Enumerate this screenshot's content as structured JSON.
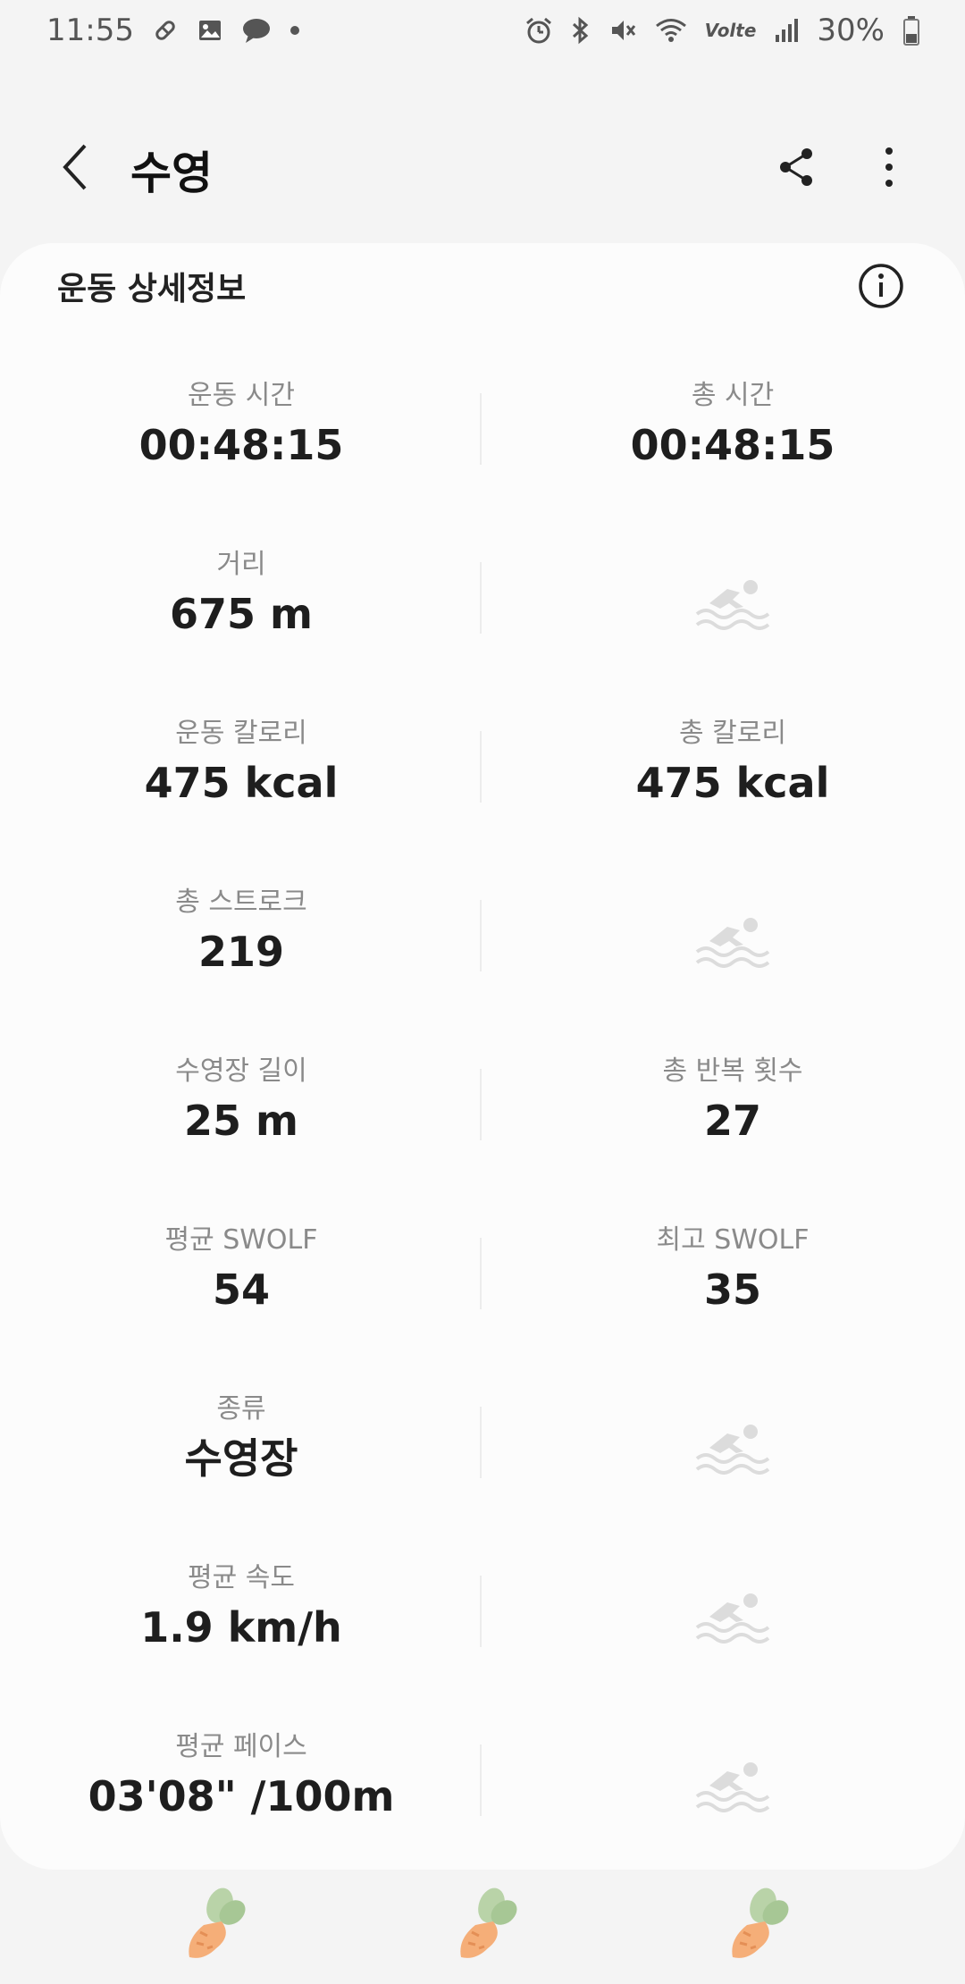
{
  "status": {
    "time": "11:55",
    "battery": "30%",
    "network": "Volte"
  },
  "header": {
    "title": "수영"
  },
  "card": {
    "title": "운동 상세정보"
  },
  "metrics": [
    {
      "left": {
        "label": "운동 시간",
        "value": "00:48:15"
      },
      "right": {
        "label": "총 시간",
        "value": "00:48:15"
      }
    },
    {
      "left": {
        "label": "거리",
        "value": "675 m"
      },
      "right": null
    },
    {
      "left": {
        "label": "운동 칼로리",
        "value": "475 kcal"
      },
      "right": {
        "label": "총 칼로리",
        "value": "475 kcal"
      }
    },
    {
      "left": {
        "label": "총 스트로크",
        "value": "219"
      },
      "right": null
    },
    {
      "left": {
        "label": "수영장 길이",
        "value": "25 m"
      },
      "right": {
        "label": "총 반복 횟수",
        "value": "27"
      }
    },
    {
      "left": {
        "label": "평균 SWOLF",
        "value": "54"
      },
      "right": {
        "label": "최고 SWOLF",
        "value": "35"
      }
    },
    {
      "left": {
        "label": "종류",
        "value": "수영장"
      },
      "right": null
    },
    {
      "left": {
        "label": "평균 속도",
        "value": "1.9 km/h"
      },
      "right": null
    },
    {
      "left": {
        "label": "평균 페이스",
        "value": "03'08\" /100m"
      },
      "right": null
    }
  ],
  "icons": {
    "placeholder": "swimmer-icon",
    "bottom": "carrot-icon"
  },
  "colors": {
    "background": "#f4f4f4",
    "card": "#fcfcfc",
    "label": "#8a8a8a",
    "value": "#1e1e1e",
    "placeholder_icon": "#dcdcdc"
  }
}
